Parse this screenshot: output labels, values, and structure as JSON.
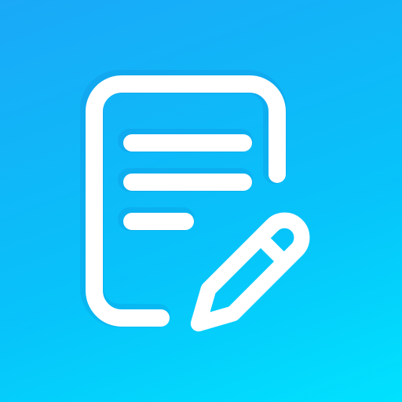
{
  "icon": {
    "name": "notes-edit-icon",
    "foreground_color": "#FFFFFF",
    "shadow_color": "#0E86D0",
    "gradient": [
      "#1AA9F7",
      "#07C3FA",
      "#00E2FE"
    ]
  }
}
